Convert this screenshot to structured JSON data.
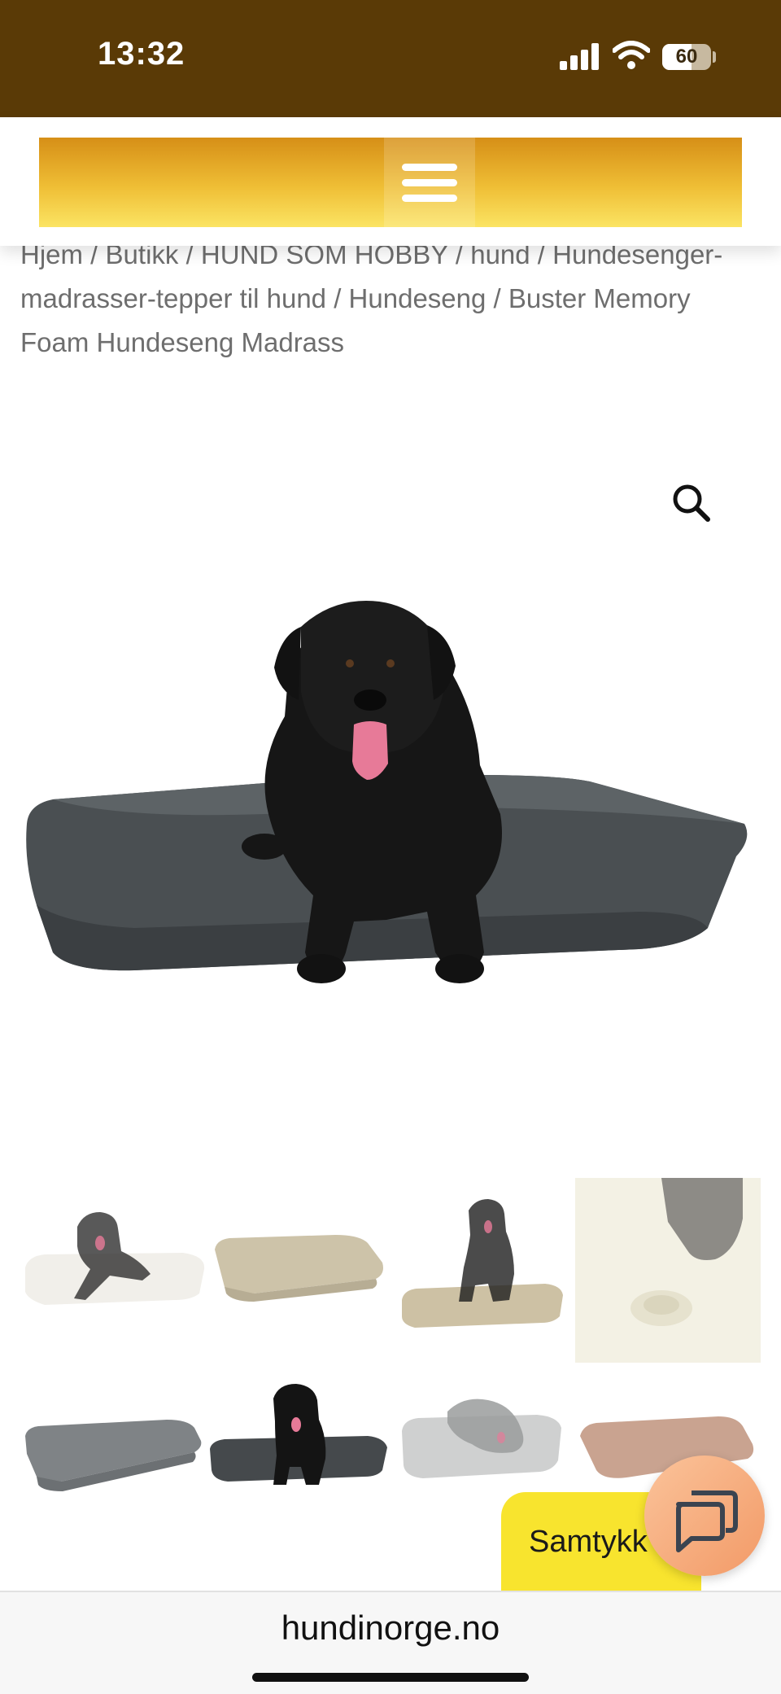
{
  "status_bar": {
    "time": "13:32",
    "battery_percent": "60",
    "battery_level": 0.6,
    "icons": [
      "cellular-signal-icon",
      "wifi-icon",
      "battery-icon"
    ]
  },
  "header": {
    "menu_icon": "hamburger-menu-icon",
    "gradient_colors": [
      "#d68f17",
      "#efbe35",
      "#fbe463"
    ]
  },
  "breadcrumb": {
    "items": [
      "Hjem",
      "Butikk",
      "HUND SOM HOBBY",
      "hund",
      "Hundesenger-madrasser-tepper til hund",
      "Hundeseng",
      "Buster Memory Foam Hundeseng Madrass"
    ],
    "separator": " / "
  },
  "gallery": {
    "zoom_icon": "magnifier-icon",
    "main_image": "black-labrador-on-dark-grey-dog-bed",
    "thumbnails": [
      "labrador-on-cream-bed",
      "beige-bed",
      "labrador-sitting-on-beige-bed",
      "memory-foam-paw-imprint",
      "grey-bed",
      "labrador-on-dark-grey-bed",
      "grey-dog-on-light-grey-bed",
      "brown-bed"
    ]
  },
  "consent": {
    "label": "Samtykk"
  },
  "chat": {
    "icon": "chat-bubbles-icon"
  },
  "browser": {
    "url": "hundinorge.no"
  },
  "colors": {
    "status_bar": "#5a3a06",
    "consent": "#f8e42e",
    "chat": "#f29a67"
  }
}
